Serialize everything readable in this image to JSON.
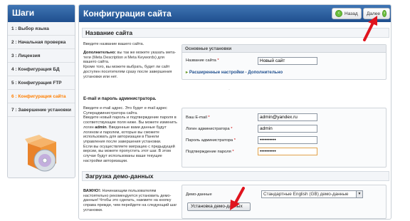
{
  "sidebar": {
    "title": "Шаги",
    "steps": [
      "1 : Выбор языка",
      "2 : Начальная проверка",
      "3 : Лицензия",
      "4 : Конфигурация БД",
      "5 : Конфигурация FTP",
      "6 : Конфигурация сайта",
      "7 : Завершение установки"
    ],
    "active_step_index": 5
  },
  "header": {
    "title": "Конфигурация сайта",
    "back_label": "Назад",
    "next_label": "Далее"
  },
  "site_name": {
    "section_title": "Название сайта",
    "intro": "Введите название вашего сайта.",
    "extra_bold": "Дополнительно:",
    "extra_text": " вы так же можете указать мета-теги (Meta Description и Meta Keywords) для вашего сайта.",
    "extra_text2": "Кроме того, вы можете выбрать, будет ли сайт доступен посетителям сразу после завершения установки или нет.",
    "box_title": "Основные установки",
    "site_name_label": "Название сайта",
    "site_name_value": "Новый сайт",
    "advanced_link": "Расширенные настройки - Дополнительно"
  },
  "admin": {
    "heading": "E-mail и пароль администратора.",
    "desc_line1": "Введите e-mail адрес. Это будет e-mail адрес Суперадминистратора сайта.",
    "desc_line2_a": "Введите новый пароль и подтверждение пароля в соответствующие поля ниже. Вы можете изменить логин ",
    "desc_line2_b": "admin",
    "desc_line2_c": ". Введенные вами данные будут логином и паролем, которые вы сможете использовать для авторизации в Панели управления после завершения установки.",
    "desc_line3": "Если вы осуществляете миграцию с предыдущей версии, вы можете пропустить этот шаг. В этом случае будут использованы ваши текущие настройки авторизации.",
    "email_label": "Ваш E-mail",
    "email_value": "admin@yandex.ru",
    "login_label": "Логин администратора",
    "login_value": "admin",
    "password_label": "Пароль администратора",
    "password_value": "••••••••••",
    "confirm_label": "Подтверждение пароля",
    "confirm_value": "••••••••••"
  },
  "demo": {
    "section_title": "Загрузка демо-данных",
    "important_bold": "ВАЖНО!:",
    "important_text": " Начинающим пользователям настоятельно рекомендуется установить демо-данные! Чтобы это сделать, нажмите на кнопку справа прежде, чем перейдете на следующий шаг установки.",
    "demo_label": "Демо-данные",
    "demo_select_value": "Стандартные English (GB) демо-данные",
    "install_button": "Установка демо-данных"
  },
  "colors": {
    "header_blue": "#1f4f8e",
    "active_step": "#ff7f00",
    "annotation_arrow": "#e0141e",
    "nav_button_green": "#6cbf3d"
  }
}
